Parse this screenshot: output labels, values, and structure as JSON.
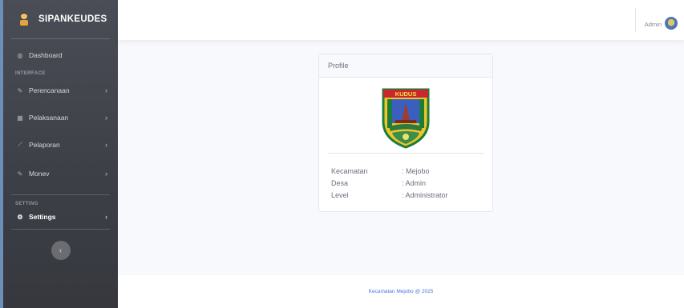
{
  "sidebar": {
    "brand": "SIPANKEUDES",
    "dashboard": "Dashboard",
    "heading_interface": "INTERFACE",
    "items": [
      {
        "label": "Perencanaan",
        "icon": "edit-icon"
      },
      {
        "label": "Pelaksanaan",
        "icon": "table-icon"
      },
      {
        "label": "Pelaporan",
        "icon": "chart-icon"
      },
      {
        "label": "Monev",
        "icon": "edit-icon"
      }
    ],
    "heading_setting": "SETTING",
    "settings": "Settings",
    "toggle_icon": "chevron-left-icon"
  },
  "topbar": {
    "user_name": "Admin"
  },
  "profile": {
    "title": "Profile",
    "emblem_text": "KUDUS",
    "rows": [
      {
        "key": "Kecamatan",
        "value": ": Mejobo"
      },
      {
        "key": "Desa",
        "value": ": Admin"
      },
      {
        "key": "Level",
        "value": ": Administrator"
      }
    ]
  },
  "footer": {
    "text": "Kecamatan Mejobo @ 2025"
  },
  "colors": {
    "sidebar_bg": "#44464d",
    "accent": "#4e73df",
    "text_muted": "#858796"
  }
}
